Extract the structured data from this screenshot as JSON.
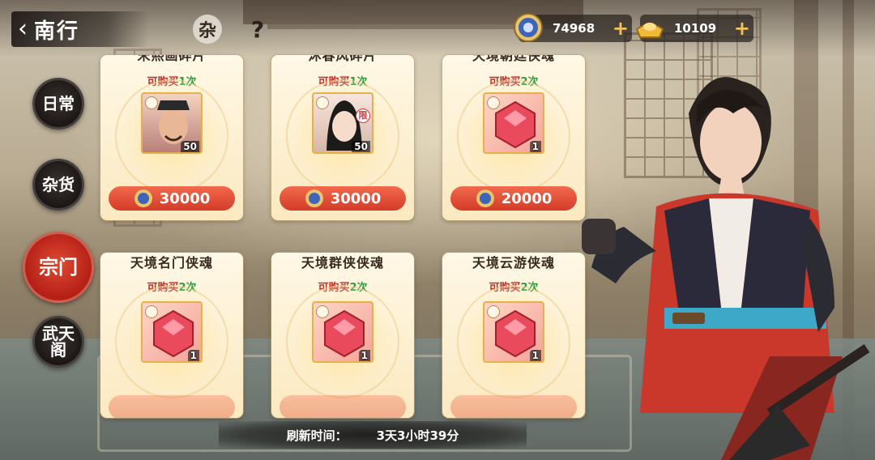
{
  "header": {
    "back_title": "南行",
    "misc_label": "杂",
    "help_label": "?"
  },
  "currencies": [
    {
      "name": "sect-coin",
      "value": "74968",
      "color": "#3f63b6"
    },
    {
      "name": "gold-ingot",
      "value": "10109",
      "color": "#f0b93a"
    }
  ],
  "nav": {
    "items": [
      {
        "label": "日常",
        "active": false
      },
      {
        "label": "杂货",
        "active": false
      },
      {
        "label": "宗门",
        "active": true
      },
      {
        "label": "武天阁",
        "active": false
      }
    ]
  },
  "shop": {
    "cards": [
      {
        "name": "宋熙画碎片",
        "limit_prefix": "可购买",
        "limit_count": "1次",
        "qty": "50",
        "price": "30000",
        "kind": "portrait-general"
      },
      {
        "name": "沐春风碎片",
        "limit_prefix": "可购买",
        "limit_count": "1次",
        "qty": "50",
        "price": "30000",
        "kind": "portrait-scholar",
        "tag": "限"
      },
      {
        "name": "天境朝廷侠魂",
        "limit_prefix": "可购买",
        "limit_count": "2次",
        "qty": "1",
        "price": "20000",
        "kind": "gem"
      },
      {
        "name": "天境名门侠魂",
        "limit_prefix": "可购买",
        "limit_count": "2次",
        "qty": "1",
        "price": "",
        "kind": "gem"
      },
      {
        "name": "天境群侠侠魂",
        "limit_prefix": "可购买",
        "limit_count": "2次",
        "qty": "1",
        "price": "",
        "kind": "gem"
      },
      {
        "name": "天境云游侠魂",
        "limit_prefix": "可购买",
        "limit_count": "2次",
        "qty": "1",
        "price": "",
        "kind": "gem"
      }
    ]
  },
  "footer": {
    "refresh_label": "刷新时间：",
    "refresh_time": "3天3小时39分"
  },
  "colors": {
    "accent": "#d43b27",
    "limit_green": "#2f9a3c",
    "gold": "#f1c25b"
  }
}
